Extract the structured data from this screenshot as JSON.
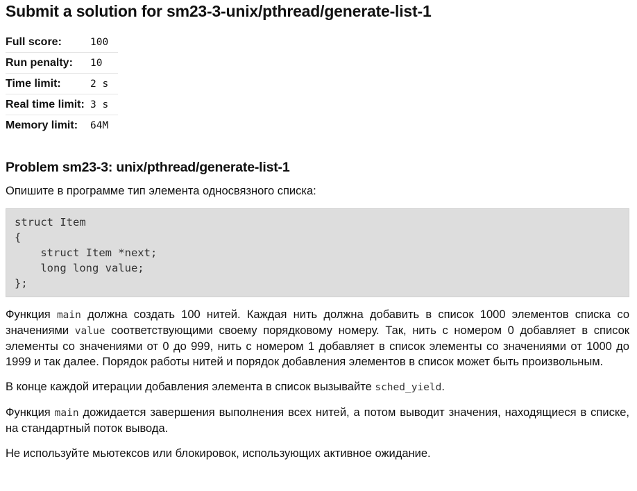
{
  "page": {
    "title": "Submit a solution for sm23-3-unix/pthread/generate-list-1"
  },
  "limits": [
    {
      "label": "Full score:",
      "value": "100"
    },
    {
      "label": "Run penalty:",
      "value": "10"
    },
    {
      "label": "Time limit:",
      "value": "2 s"
    },
    {
      "label": "Real time limit:",
      "value": "3 s"
    },
    {
      "label": "Memory limit:",
      "value": "64M"
    }
  ],
  "problem": {
    "title": "Problem sm23-3: unix/pthread/generate-list-1",
    "intro": "Опишите в программе тип элемента односвязного списка:",
    "code": "struct Item\n{\n    struct Item *next;\n    long long value;\n};",
    "p1": {
      "a": "Функция ",
      "code1": "main",
      "b": " должна создать 100 нитей. Каждая нить должна добавить в список 1000 элементов списка со значениями ",
      "code2": "value",
      "c": " соответствующими своему порядковому номеру. Так, нить с номером 0 добавляет в список элементы со значениями от 0 до 999, нить с номером 1 добавляет в список элементы со значениями от 1000 до 1999 и так далее. Порядок работы нитей и порядок добавления элементов в список может быть произвольным."
    },
    "p2": {
      "a": "В конце каждой итерации добавления элемента в список вызывайте ",
      "code1": "sched_yield",
      "b": "."
    },
    "p3": {
      "a": "Функция ",
      "code1": "main",
      "b": " дожидается завершения выполнения всех нитей, а потом выводит значения, находящиеся в списке, на стандартный поток вывода."
    },
    "p4": "Не используйте мьютексов или блокировок, использующих активное ожидание."
  }
}
